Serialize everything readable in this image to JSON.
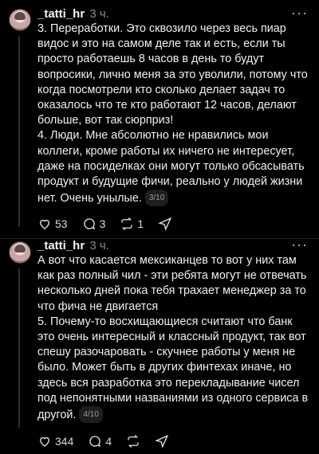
{
  "post1": {
    "username": "_tatti_hr",
    "time": "3 ч.",
    "more": "···",
    "paragraphs": [
      "3. Переработки. Это сквозило через весь пиар видос и это на самом деле так и есть, если ты просто работаешь 8 часов в день то будут вопросики, лично меня за это уволили, потому что когда посмотрели кто сколько делает задач то оказалось что те кто работают 12 часов, делают больше, вот так сюрприз!",
      "4. Люди. Мне абсолютно не нравились мои коллеги, кроме работы их ничего не интересует, даже на посиделках они могут только обсасывать продукт и будущие фичи, реально у людей жизни нет. Очень  унылые."
    ],
    "pager": "3/10",
    "likes": "53",
    "comments": "3",
    "reposts": "1"
  },
  "post2": {
    "username": "_tatti_hr",
    "time": "3 ч.",
    "more": "···",
    "paragraphs": [
      "А вот что касается мексиканцев то вот у них там как раз полный чил - эти ребята могут не отвечать несколько дней пока тебя трахает менеджер за то что фича не двигается",
      "5. Почему-то восхищающиеся считают что банк это очень интересный и классный продукт, так вот спешу разочаровать - скучнее работы у меня не было. Может быть в других финтехах иначе, но здесь вся разработка это перекладывание чисел под непонятными названиями из одного сервиса в другой."
    ],
    "pager": "4/10",
    "likes": "344",
    "comments": "4",
    "reposts": ""
  }
}
